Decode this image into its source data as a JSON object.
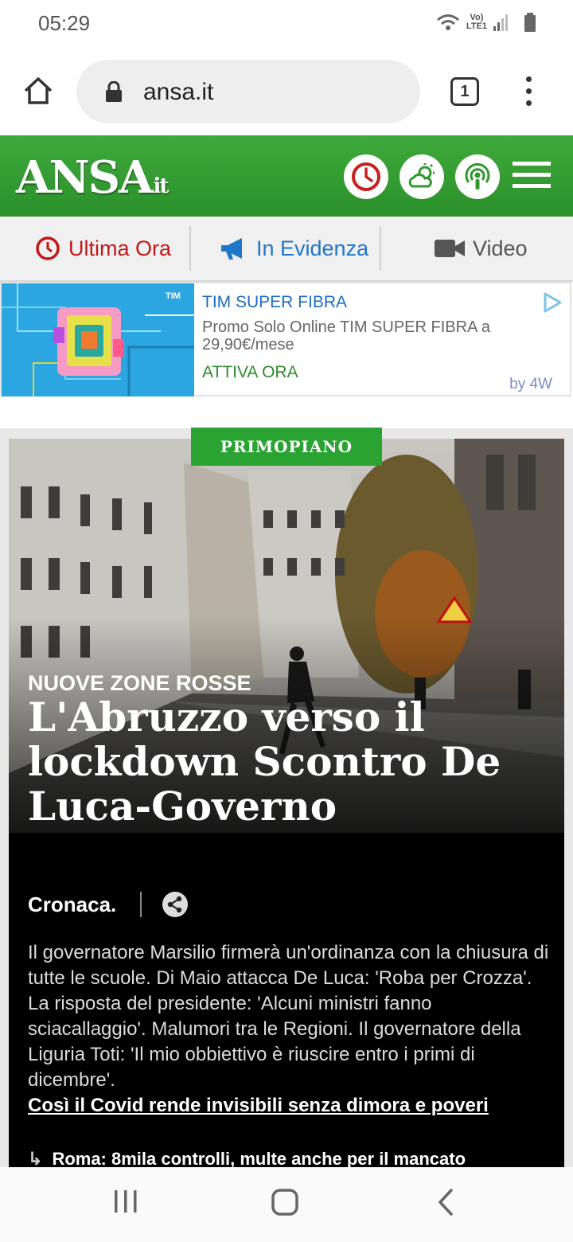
{
  "status_bar": {
    "time": "05:29",
    "network": "LTE1",
    "volte": "Vo)"
  },
  "browser": {
    "url": "ansa.it",
    "tab_count": "1"
  },
  "site": {
    "logo": "ANSA",
    "logo_suffix": "it",
    "accent_color": "#2e9a2c"
  },
  "section_nav": {
    "items": [
      {
        "label": "Ultima Ora",
        "color": "#c21818",
        "icon": "clock-icon"
      },
      {
        "label": "In Evidenza",
        "color": "#1f77c8",
        "icon": "megaphone-icon"
      },
      {
        "label": "Video",
        "color": "#555555",
        "icon": "video-camera-icon"
      }
    ]
  },
  "ad": {
    "brand": "TIM",
    "title": "TIM SUPER FIBRA",
    "description": "Promo Solo Online TIM SUPER FIBRA a 29,90€/mese",
    "cta": "ATTIVA ORA",
    "by": "by 4W"
  },
  "feature": {
    "badge": "PRIMOPIANO",
    "kicker": "NUOVE ZONE ROSSE",
    "headline": "L'Abruzzo verso il lockdown Scontro De Luca-Governo",
    "category": "Cronaca.",
    "abstract": "Il governatore Marsilio firmerà un'ordinanza con la chiusura di tutte le scuole. Di Maio attacca De Luca: 'Roba per Crozza'. La risposta del presidente: 'Alcuni ministri fanno sciacallaggio'. Malumori tra le Regioni. Il governatore della Liguria Toti: 'Il mio obbiettivo è riuscire entro i primi di dicembre'.",
    "related_link": "Così il Covid rende invisibili senza dimora e poveri",
    "related_item": "Roma: 8mila controlli, multe anche per il mancato"
  }
}
